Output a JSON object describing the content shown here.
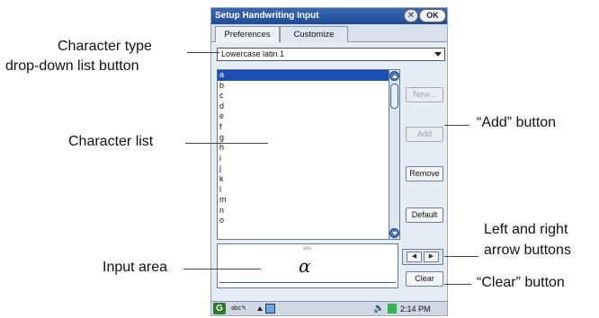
{
  "window": {
    "title": "Setup Handwriting Input",
    "close_label": "✕",
    "ok_label": "OK"
  },
  "tabs": [
    {
      "label": "Preferences"
    },
    {
      "label": "Customize",
      "active": true
    }
  ],
  "character_type": {
    "selected": "Lowercase latin 1"
  },
  "character_list": {
    "items": [
      "a",
      "b",
      "c",
      "d",
      "e",
      "f",
      "g",
      "h",
      "i",
      "j",
      "k",
      "l",
      "m",
      "n",
      "o"
    ],
    "selected_index": 0
  },
  "buttons": {
    "new": "New...",
    "add": "Add",
    "remove": "Remove",
    "default": "Default",
    "clear": "Clear"
  },
  "input_area": {
    "hint": "abc",
    "glyph": "α"
  },
  "taskbar": {
    "logo": "G",
    "input_mode": "abc",
    "time": "2:14 PM"
  },
  "callouts": {
    "character_type_line1": "Character type",
    "character_type_line2": "drop-down list button",
    "character_list": "Character list",
    "input_area": "Input area",
    "add_button": "“Add” button",
    "arrows_line1": "Left and right",
    "arrows_line2": "arrow buttons",
    "clear_button": "“Clear” button"
  }
}
